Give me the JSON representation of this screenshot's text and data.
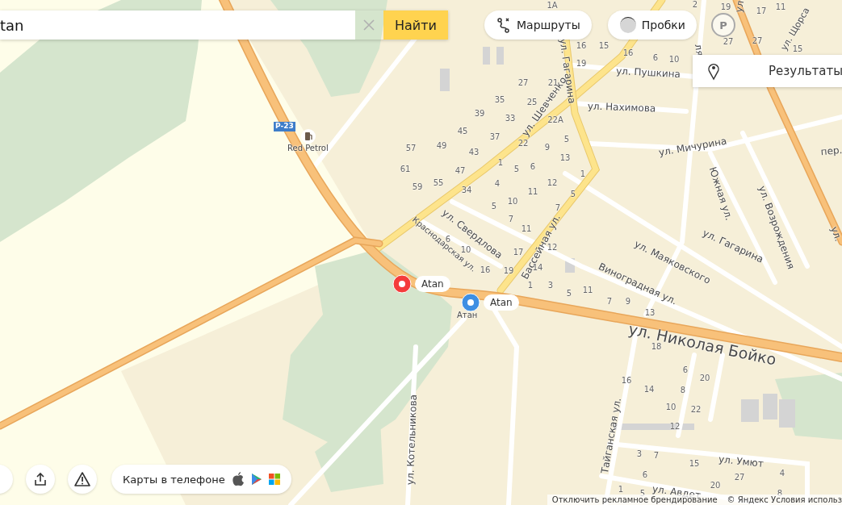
{
  "search": {
    "value": "tan",
    "button": "Найти"
  },
  "top_buttons": [
    {
      "kind": "routes",
      "label": "Маршруты"
    },
    {
      "kind": "traffic",
      "label": "Пробки"
    }
  ],
  "parking_sign": "P",
  "results_panel": {
    "label": "Результаты"
  },
  "map": {
    "highway_shield": "Р-23",
    "poi": "Red Petrol",
    "place_label": "Атан",
    "street_labels": [
      "ул. Гагарина",
      "ул. Пушкина",
      "ул. Нахимова",
      "ул. Шевченко",
      "ул. Мичурина",
      "ул. Щорса",
      "пер.",
      "Южная ул.",
      "ул. Возрождения",
      "ул. Гагарина",
      "ул. Маяковского",
      "Бассейная ул.",
      "ул. Свердлова",
      "Краснодарская ул.",
      "Виноградная ул.",
      "ул. Николая Бойко",
      "Тайганская ул.",
      "ул. Умют",
      "ул. Авдет",
      "ул. Котельникова",
      "ул",
      "ля",
      "ул."
    ],
    "house_numbers": [
      "1А",
      "16",
      "15",
      "16",
      "6",
      "10",
      "19",
      "2",
      "19",
      "17",
      "11",
      "27",
      "27",
      "15",
      "27",
      "21",
      "35",
      "25",
      "39",
      "33",
      "22А",
      "45",
      "37",
      "22",
      "5",
      "49",
      "43",
      "9",
      "13",
      "1",
      "5",
      "6",
      "47",
      "1",
      "55",
      "34",
      "4",
      "12",
      "11",
      "5",
      "10",
      "5",
      "7",
      "7",
      "11",
      "6",
      "10",
      "17",
      "12",
      "57",
      "61",
      "59",
      "16",
      "19",
      "14",
      "1",
      "3",
      "5",
      "11",
      "7",
      "9",
      "13",
      "18",
      "6",
      "20",
      "16",
      "14",
      "8",
      "10",
      "22",
      "12",
      "3",
      "7",
      "15",
      "6",
      "27",
      "4",
      "20",
      "1",
      "5",
      "8"
    ]
  },
  "pins": [
    {
      "label": "Atan",
      "color": "#f43b3b"
    },
    {
      "label": "Atan",
      "color": "#3e8fe3"
    }
  ],
  "app_promo": {
    "label": "Карты в телефоне"
  },
  "footer": {
    "ad_link": "Отключить рекламное брендирование",
    "copyright": "© Яндекс Условия использ"
  }
}
